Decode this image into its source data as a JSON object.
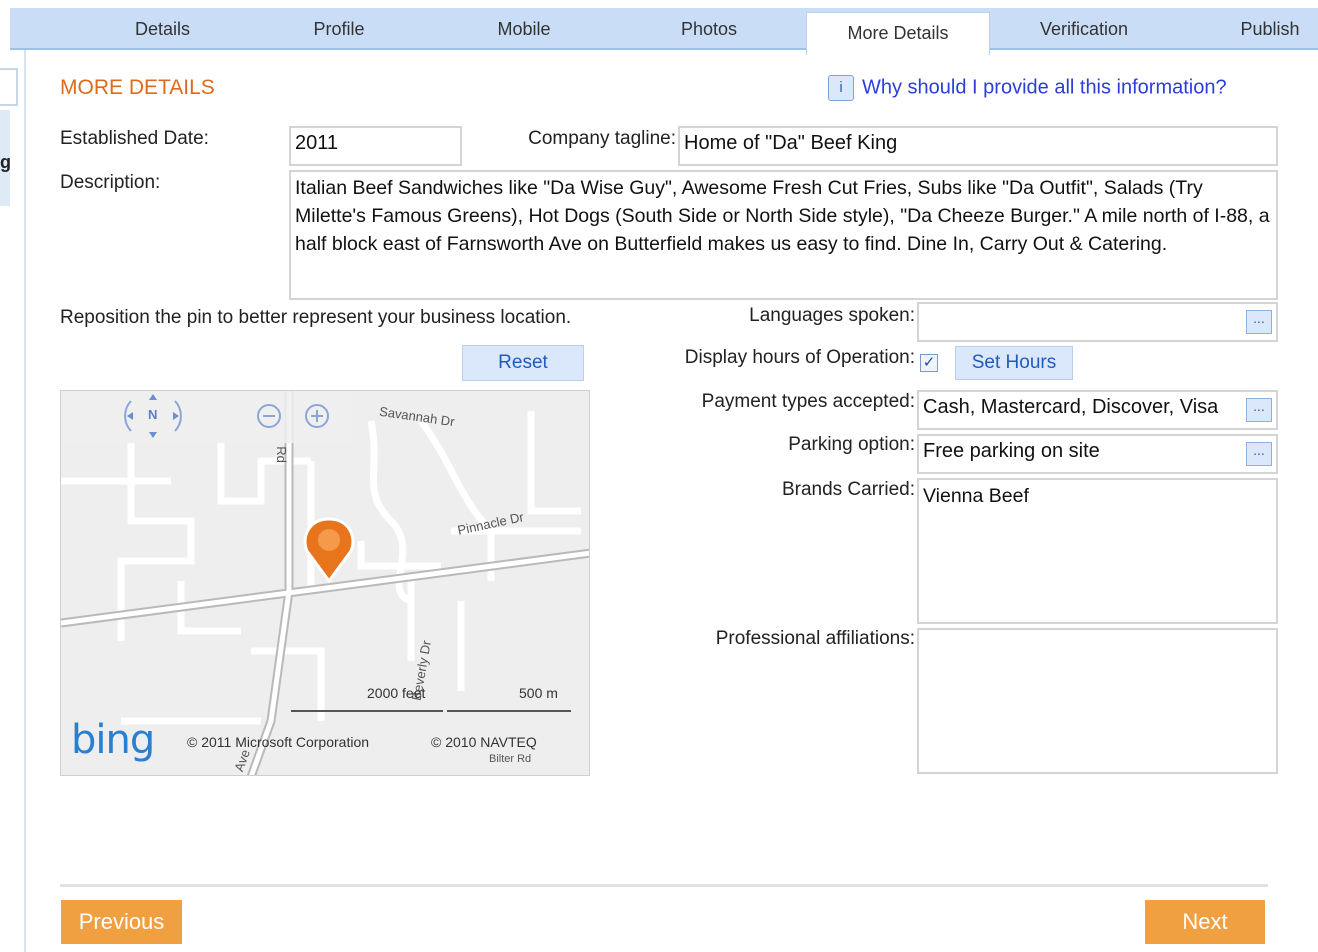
{
  "tabs": [
    {
      "label": "Details",
      "active": false
    },
    {
      "label": "Profile",
      "active": false
    },
    {
      "label": "Mobile",
      "active": false
    },
    {
      "label": "Photos",
      "active": false
    },
    {
      "label": "More Details",
      "active": true
    },
    {
      "label": "Verification",
      "active": false
    },
    {
      "label": "Publish",
      "active": false
    }
  ],
  "section": {
    "title": "MORE DETAILS"
  },
  "help": {
    "icon": "info-icon",
    "link": "Why should I provide all this information?"
  },
  "form": {
    "established_label": "Established Date:",
    "established_value": "2011",
    "tagline_label": "Company tagline:",
    "tagline_value": "Home of \"Da\" Beef King",
    "description_label": "Description:",
    "description_value": "Italian Beef Sandwiches like \"Da Wise Guy\", Awesome Fresh Cut Fries, Subs like \"Da Outfit\", Salads (Try Milette's Famous Greens), Hot Dogs (South Side or North Side style), \"Da Cheeze Burger.\"  A mile north of I-88, a half block east of Farnsworth Ave on Butterfield makes us easy to find.  Dine In, Carry Out & Catering.",
    "pin_note": "Reposition the pin to better represent your business location.",
    "reset_label": "Reset",
    "languages_label": "Languages spoken:",
    "languages_value": "",
    "hours_label": "Display hours of Operation:",
    "hours_checked": true,
    "set_hours_label": "Set Hours",
    "payment_label": "Payment types accepted:",
    "payment_value": "Cash, Mastercard, Discover, Visa",
    "parking_label": "Parking option:",
    "parking_value": "Free parking on site",
    "brands_label": "Brands Carried:",
    "brands_value": "Vienna Beef",
    "affiliations_label": "Professional affiliations:",
    "affiliations_value": "",
    "ellipsis": "..."
  },
  "map": {
    "compass": "N",
    "streets": [
      "Savannah Dr",
      "Pinnacle Dr",
      "Rd",
      "Beverly Dr",
      "Ave",
      "Bilter Rd"
    ],
    "scale_feet": "2000 feet",
    "scale_m": "500 m",
    "logo": "bing",
    "copyright": "© 2011 Microsoft Corporation",
    "copyright2": "© 2010 NAVTEQ",
    "colors": {
      "pin": "#e8741c",
      "road": "#ffffff",
      "land": "#eeeeee"
    }
  },
  "nav": {
    "previous": "Previous",
    "next": "Next"
  },
  "colors": {
    "accent": "#e06a1c",
    "tab_bar": "#c9ddf6",
    "button_orange": "#f0a040",
    "link": "#2a3fd6"
  }
}
